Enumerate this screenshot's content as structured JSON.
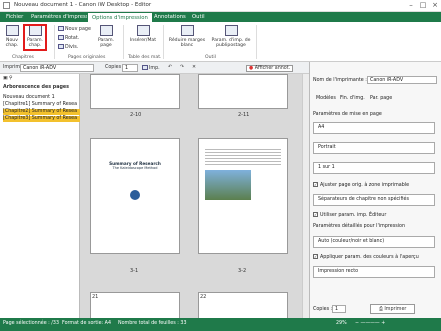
{
  "window": {
    "title": "Nouveau document 1 - Canon iW Desktop - Editor"
  },
  "menu": {
    "tabs": [
      "Fichier",
      "Paramètres d'impression",
      "Options d'impression",
      "Annotations",
      "Outil"
    ]
  },
  "ribbon": {
    "nouv_chap": "Nouv chap.",
    "param_chap": "Param. chap.",
    "group_chapitres": "Chapitres",
    "nouv_page": "Nouv page",
    "rotat": "Rotat.",
    "divis": "Divis.",
    "param_page": "Param. page",
    "group_pages": "Pages originales",
    "inserer_mat": "Insérer/Mat",
    "group_table": "Table des mat.",
    "reduire": "Réduire marges blanc",
    "param_imp": "Param. d'imp. de publipostage",
    "group_outil": "Outil"
  },
  "printbar": {
    "label": "Imprim",
    "printer": "Canon iR-ADV",
    "copies_label": "Copies",
    "copies": "1",
    "print_btn": "Imp.",
    "zoom_btn": "Afficher annot."
  },
  "left": {
    "title": "Arborescence des pages",
    "items": [
      {
        "label": "Nouveau document 1"
      },
      {
        "label": "[Chapitre1] Summary of Resea"
      },
      {
        "label": "[Chapitre2] Summary of Resea"
      },
      {
        "label": "[Chapitre3] Summary of Resea"
      }
    ]
  },
  "pages": {
    "labels": [
      "2-10",
      "2-11",
      "3-1",
      "3-2",
      "21",
      "22"
    ],
    "doc_title": "Summary of Research",
    "doc_sub": "The Kaleidoscope Method"
  },
  "right": {
    "printer_label": "Nom de l'imprimante :",
    "printer": "Canon iR-ADV",
    "tabs": [
      "Modèles",
      "Fin. d'img.",
      "Par. page"
    ],
    "mise_label": "Paramètres de mise en page",
    "paper": "A4",
    "orientation": "Portrait",
    "nup": "1 sur 1",
    "ajuster": "Ajuster page orig. à zone imprimable",
    "separateur": "Séparateurs de chapitre non spécifiés",
    "utiliser": "Utiliser param. imp. Éditeur",
    "detailles": "Paramètres détaillés pour l'impression",
    "couleur": "Auto (couleur/noir et blanc)",
    "appliquer": "Appliquer param. des couleurs à l'aperçu",
    "recto": "Impression recto",
    "copies_label": "Copies :",
    "copies": "1",
    "imprimer": "Imprimer"
  },
  "status": {
    "page": "Page sélectionnée : /33",
    "format": "Format de sortie: A4",
    "total": "Nombre total de feuilles : 33",
    "zoom": "29%"
  },
  "colors": {
    "accent": "#1f7a4a",
    "highlight": "#e21b1b",
    "selected": "#f3c12d"
  }
}
